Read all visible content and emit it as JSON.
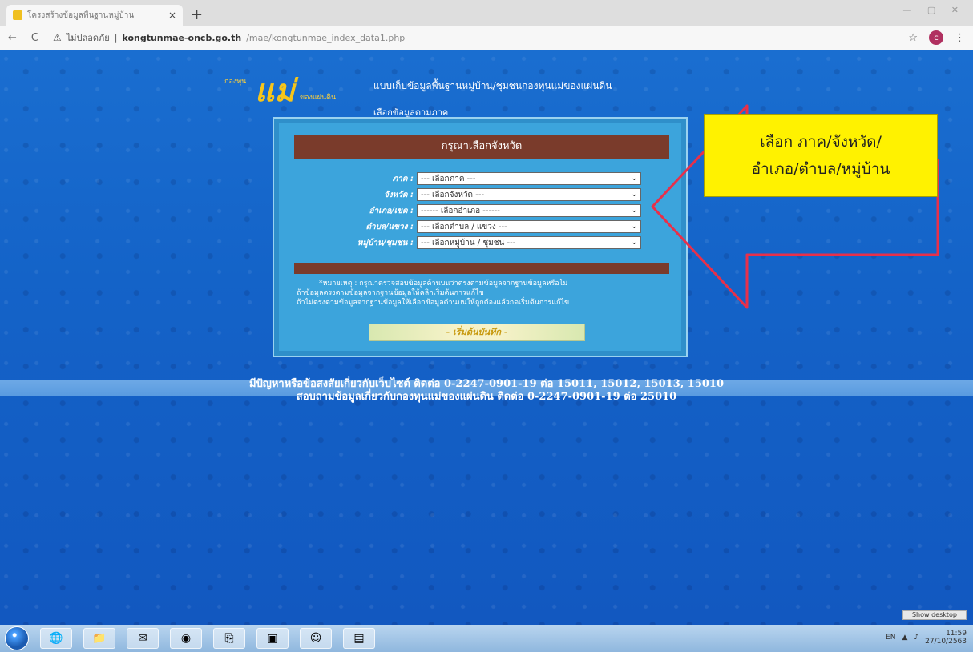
{
  "browser": {
    "tab_title": "โครงสร้างข้อมูลพื้นฐานหมู่บ้าน",
    "tab_close": "×",
    "new_tab": "+",
    "nav_back": "←",
    "nav_reload": "C",
    "security_text": "ไม่ปลอดภัย",
    "url_host": "kongtunmae-oncb.go.th",
    "url_path": "/mae/kongtunmae_index_data1.php",
    "star_icon": "☆",
    "profile_initial": "c",
    "menu_icon": "⋮",
    "window_controls": "— ▢ ✕"
  },
  "header": {
    "logo_top": "กองทุน",
    "logo_main": "แม่",
    "logo_bottom": "ของแผ่นดิน",
    "title": "แบบเก็บข้อมูลพื้นฐานหมู่บ้าน/ชุมชนกองทุนแม่ของแผ่นดิน",
    "subtitle": "เลือกข้อมูลตามภาค"
  },
  "form": {
    "panel_title": "กรุณาเลือกจังหวัด",
    "fields": [
      {
        "label": "ภาค :",
        "value": "--- เลือกภาค ---"
      },
      {
        "label": "จังหวัด :",
        "value": "--- เลือกจังหวัด ---"
      },
      {
        "label": "อำเภอ/เขต :",
        "value": "------ เลือกอำเภอ ------"
      },
      {
        "label": "ตำบล/แขวง :",
        "value": "--- เลือกตำบล / แขวง ---"
      },
      {
        "label": "หมู่บ้าน/ชุมชน :",
        "value": "--- เลือกหมู่บ้าน / ชุมชน ---"
      }
    ],
    "note_line1": "*หมายเหตุ : กรุณาตรวจสอบข้อมูลด้านบนว่าตรงตามข้อมูลจากฐานข้อมูลหรือไม่",
    "note_line2": "ถ้าข้อมูลตรงตามข้อมูลจากฐานข้อมูลให้คลิกเริ่มต้นการแก้ไข",
    "note_line3": "ถ้าไม่ตรงตามข้อมูลจากฐานข้อมูลให้เลือกข้อมูลด้านบนให้ถูกต้องแล้วกดเริ่มต้นการแก้ไข",
    "start_button": "- เริ่มต้นบันทึก -"
  },
  "contact": {
    "line1": "มีปัญหาหรือข้อสงสัยเกี่ยวกับเว็บไซต์ ติดต่อ 0-2247-0901-19 ต่อ 15011, 15012, 15013, 15010",
    "line2": "สอบถามข้อมูลเกี่ยวกับกองทุนแม่ของแผ่นดิน ติดต่อ 0-2247-0901-19 ต่อ 25010"
  },
  "callout": {
    "line1": "เลือก ภาค/จังหวัด/",
    "line2": "อำเภอ/ตำบล/หมู่บ้าน"
  },
  "os": {
    "show_desktop": "Show desktop",
    "lang": "EN",
    "time": "11:59",
    "date": "27/10/2563"
  },
  "colors": {
    "page_blue": "#1463c8",
    "panel_blue": "#3ca4dc",
    "title_brown": "#7a3b2b",
    "callout_yellow": "#fff200",
    "arrow_red": "#e8304a"
  }
}
